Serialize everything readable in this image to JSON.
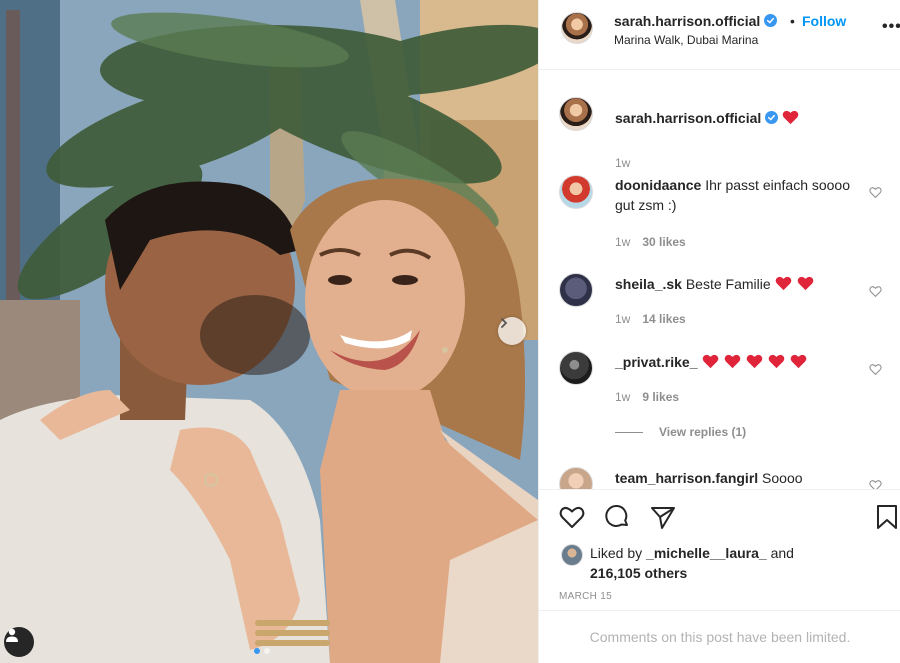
{
  "post": {
    "username": "sarah.harrison.official",
    "separator": "•",
    "follow_label": "Follow",
    "location": "Marina Walk, Dubai Marina",
    "more_label": "•••",
    "caption_time": "1w"
  },
  "comments": [
    {
      "username": "doonidaance",
      "text": "Ihr passt einfach soooo gut zsm :)",
      "time": "1w",
      "likes": "30 likes"
    },
    {
      "username": "sheila_.sk",
      "text": "Beste Familie",
      "time": "1w",
      "likes": "14 likes"
    },
    {
      "username": "_privat.rike_",
      "text": "",
      "time": "1w",
      "likes": "9 likes"
    },
    {
      "username": "team_harrison.fangirl",
      "text": "Soooo"
    }
  ],
  "view_replies": "View replies (1)",
  "likes": {
    "prefix": "Liked by",
    "user": "_michelle__laura_",
    "middle": "and",
    "count": "216,105 others"
  },
  "date": "MARCH 15",
  "limited_notice": "Comments on this post have been limited.",
  "icons": [
    "verified-badge-icon",
    "heart-icon",
    "comment-icon",
    "share-icon",
    "bookmark-icon",
    "chevron-right-icon",
    "user-tag-icon"
  ],
  "colors": {
    "follow": "#0095f6",
    "verified": "#3897f0",
    "heart": "#ed4956",
    "muted": "#8e8e8e"
  }
}
